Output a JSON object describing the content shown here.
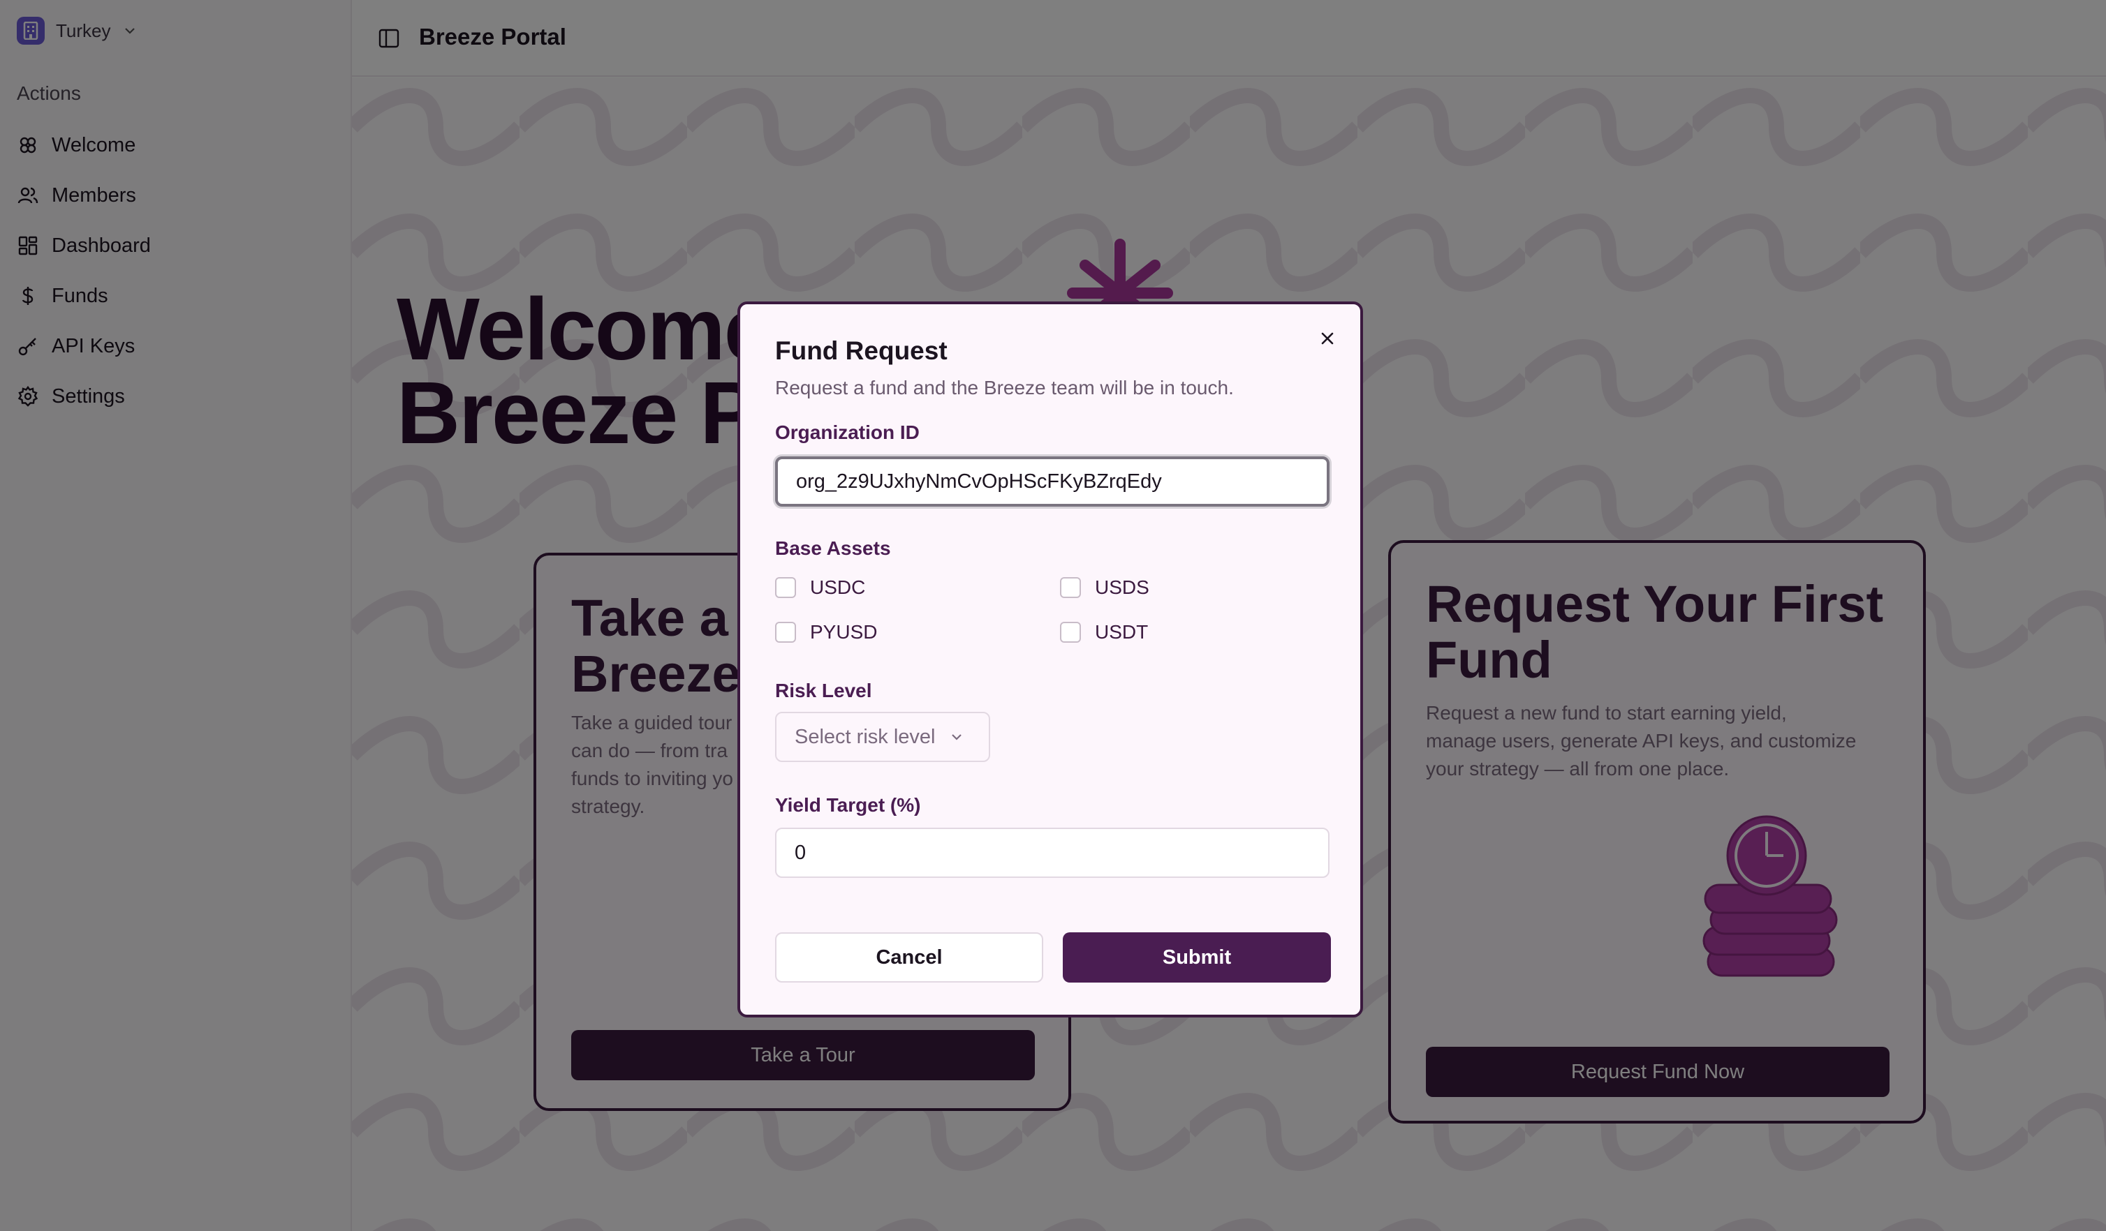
{
  "sidebar": {
    "org_name": "Turkey",
    "section_label": "Actions",
    "items": [
      {
        "label": "Welcome",
        "icon": "welcome-icon"
      },
      {
        "label": "Members",
        "icon": "members-icon"
      },
      {
        "label": "Dashboard",
        "icon": "dashboard-icon"
      },
      {
        "label": "Funds",
        "icon": "dollar-icon"
      },
      {
        "label": "API Keys",
        "icon": "key-icon"
      },
      {
        "label": "Settings",
        "icon": "gear-icon"
      }
    ]
  },
  "header": {
    "title": "Breeze Portal"
  },
  "hero": {
    "line1": "Welcome",
    "line2": "Breeze P"
  },
  "cards": {
    "tour": {
      "title_line1": "Take a",
      "title_line2": "Breeze",
      "desc_lines": [
        "Take a guided tour",
        "can do — from tra",
        "funds to inviting yo",
        "strategy."
      ],
      "button": "Take a Tour"
    },
    "fund": {
      "title_line1": "Request Your First",
      "title_line2": "Fund",
      "desc_lines": [
        "Request a new fund to start earning yield,",
        "manage users, generate API keys, and customize",
        "your strategy — all from one place."
      ],
      "button": "Request Fund Now"
    }
  },
  "modal": {
    "title": "Fund Request",
    "description": "Request a fund and the Breeze team will be in touch.",
    "org_id_label": "Organization ID",
    "org_id_value": "org_2z9UJxhyNmCvOpHScFKyBZrqEdy",
    "base_assets_label": "Base Assets",
    "assets": [
      {
        "label": "USDC",
        "checked": false
      },
      {
        "label": "USDS",
        "checked": false
      },
      {
        "label": "PYUSD",
        "checked": false
      },
      {
        "label": "USDT",
        "checked": false
      }
    ],
    "risk_label": "Risk Level",
    "risk_placeholder": "Select risk level",
    "yield_label": "Yield Target (%)",
    "yield_value": "0",
    "cancel": "Cancel",
    "submit": "Submit"
  },
  "colors": {
    "brand": "#3b1a3f",
    "accent": "#4a1d52",
    "org_logo": "#6b5bd6",
    "hero_icon": "#a8379b"
  }
}
